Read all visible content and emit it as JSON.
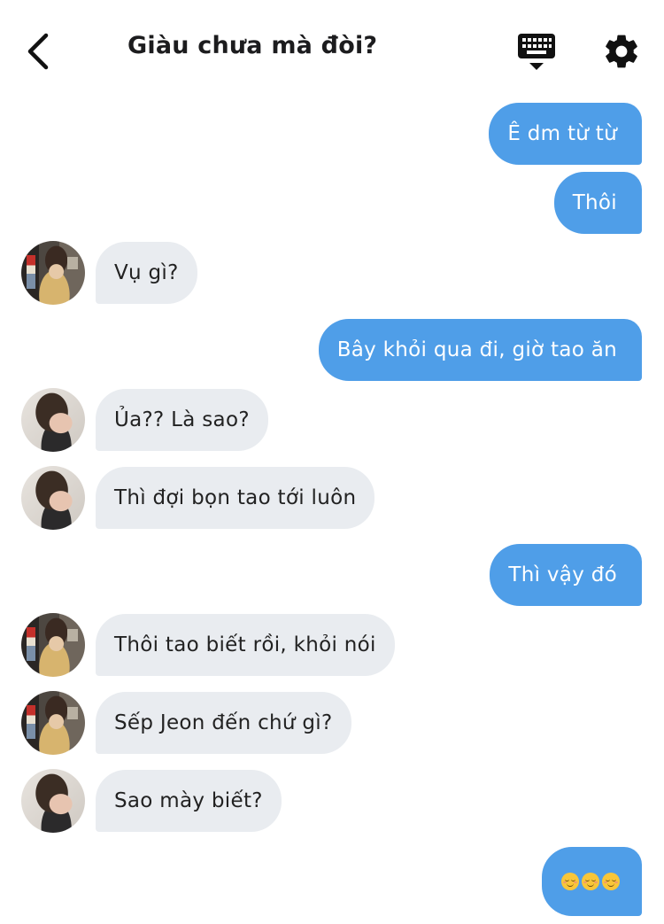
{
  "header": {
    "title": "Giàu chưa mà đòi?",
    "icons": {
      "back": "chevron-left-icon",
      "keyboard": "keyboard-hide-icon",
      "settings": "gear-icon"
    }
  },
  "colors": {
    "outgoing_bubble": "#4f9ee8",
    "incoming_bubble": "#e9ecf0"
  },
  "messages": [
    {
      "direction": "out",
      "text": "Ê dm từ từ"
    },
    {
      "direction": "out",
      "text": "Thôi"
    },
    {
      "direction": "in",
      "sender": "avatar-a",
      "text": "Vụ gì?"
    },
    {
      "direction": "out",
      "text": "Bây khỏi qua đi, giờ tao ăn"
    },
    {
      "direction": "in",
      "sender": "avatar-b",
      "text": "Ủa?? Là sao?"
    },
    {
      "direction": "in",
      "sender": "avatar-b",
      "text": "Thì đợi bọn tao tới luôn"
    },
    {
      "direction": "out",
      "text": "Thì vậy đó"
    },
    {
      "direction": "in",
      "sender": "avatar-a",
      "text": "Thôi tao biết rồi, khỏi nói"
    },
    {
      "direction": "in",
      "sender": "avatar-a",
      "text": "Sếp Jeon đến chứ gì?"
    },
    {
      "direction": "in",
      "sender": "avatar-b",
      "text": "Sao mày biết?"
    },
    {
      "direction": "out",
      "text": "😌😌😌",
      "emoji_name": "relieved-face-icon",
      "emoji_count": 3
    }
  ]
}
